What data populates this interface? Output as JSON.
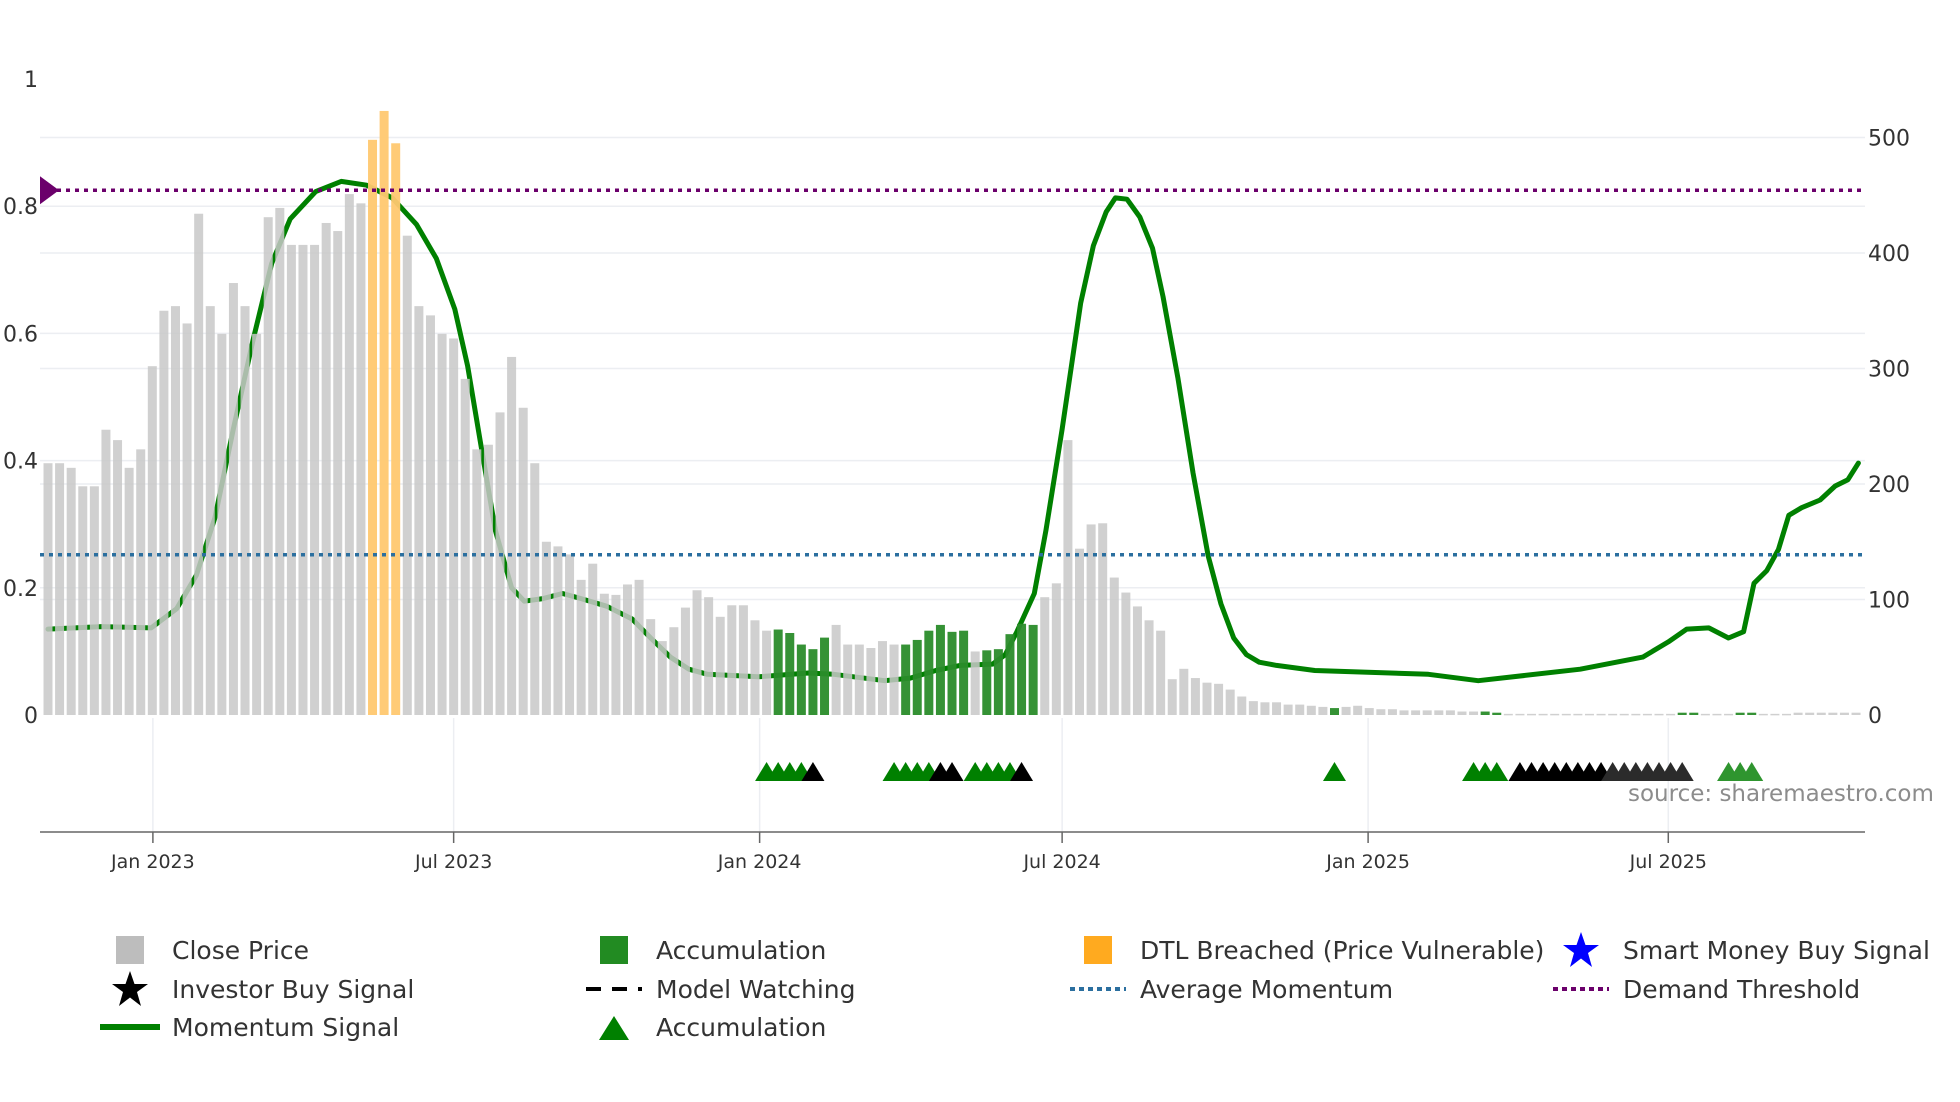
{
  "chart_data": {
    "type": "bar",
    "title": "",
    "source": "source: sharemaestro.com",
    "x_unit": "week index (weekly bars)",
    "x_ticks": [
      {
        "label": "Jan 2023",
        "week": 9.05
      },
      {
        "label": "Jul 2023",
        "week": 35.0
      },
      {
        "label": "Jan 2024",
        "week": 61.4
      },
      {
        "label": "Jul 2024",
        "week": 87.5
      },
      {
        "label": "Jan 2025",
        "week": 113.9
      },
      {
        "label": "Jul 2025",
        "week": 139.8
      }
    ],
    "y_left": {
      "ticks": [
        "0",
        "0.2",
        "0.4",
        "0.6",
        "0.8",
        "1"
      ],
      "tick_values": [
        0,
        0.2,
        0.4,
        0.6,
        0.8,
        1
      ],
      "range": [
        0,
        1
      ]
    },
    "y_right": {
      "ticks": [
        "0",
        "100",
        "200",
        "300",
        "400",
        "500"
      ],
      "tick_values": [
        0,
        100,
        200,
        300,
        400,
        500
      ],
      "range": [
        0,
        550
      ]
    },
    "close_price": [
      218,
      218,
      214,
      198,
      198,
      247,
      238,
      214,
      230,
      302,
      350,
      354,
      339,
      434,
      354,
      330,
      374,
      354,
      330,
      431,
      439,
      407,
      407,
      407,
      426,
      419,
      451,
      443,
      498,
      523,
      495,
      415,
      354,
      346,
      330,
      326,
      291,
      230,
      234,
      262,
      310,
      266,
      218,
      150,
      146,
      139,
      117,
      131,
      105,
      104,
      113,
      117,
      83,
      64,
      76,
      93,
      108,
      102,
      85,
      95,
      95,
      82,
      73,
      74,
      71,
      61,
      57,
      67,
      78,
      61,
      61,
      58,
      64,
      61,
      61,
      65,
      73,
      78,
      72,
      73,
      55,
      56,
      57,
      70,
      79,
      78,
      102,
      114,
      238,
      144,
      165,
      166,
      119,
      106,
      94,
      82,
      73,
      31,
      40,
      32,
      28,
      27,
      22,
      16,
      12,
      11,
      11,
      9,
      9,
      8,
      7,
      6,
      7,
      8,
      6,
      5,
      5,
      4,
      4,
      4,
      4,
      4,
      3,
      3,
      3,
      2,
      1,
      1,
      1,
      1,
      1,
      1,
      1,
      1,
      1,
      1,
      1,
      1,
      1,
      1,
      1,
      2,
      2,
      1,
      1,
      1,
      2,
      2,
      1,
      1,
      1,
      2,
      2,
      2,
      2,
      2,
      2
    ],
    "accumulation_weeks": [
      63,
      64,
      65,
      66,
      67,
      74,
      75,
      76,
      77,
      78,
      79,
      81,
      82,
      83,
      84,
      85,
      111,
      124,
      125,
      141,
      142,
      146,
      147
    ],
    "dtl_breached_weeks": [
      28,
      29,
      30
    ],
    "momentum_signal": [
      [
        0,
        0.135
      ],
      [
        4.6,
        0.139
      ],
      [
        8.9,
        0.137
      ],
      [
        11.1,
        0.167
      ],
      [
        12.8,
        0.22
      ],
      [
        14.4,
        0.31
      ],
      [
        16.0,
        0.45
      ],
      [
        17.7,
        0.59
      ],
      [
        19.3,
        0.71
      ],
      [
        20.9,
        0.78
      ],
      [
        23.1,
        0.823
      ],
      [
        25.3,
        0.839
      ],
      [
        27.5,
        0.833
      ],
      [
        29.7,
        0.813
      ],
      [
        31.8,
        0.771
      ],
      [
        33.5,
        0.718
      ],
      [
        35.1,
        0.638
      ],
      [
        36.2,
        0.549
      ],
      [
        37.3,
        0.43
      ],
      [
        38.6,
        0.29
      ],
      [
        40.0,
        0.2
      ],
      [
        41.1,
        0.179
      ],
      [
        42.7,
        0.183
      ],
      [
        44.4,
        0.191
      ],
      [
        46.0,
        0.183
      ],
      [
        48.2,
        0.171
      ],
      [
        50.4,
        0.151
      ],
      [
        52.0,
        0.121
      ],
      [
        53.7,
        0.091
      ],
      [
        55.3,
        0.072
      ],
      [
        56.9,
        0.064
      ],
      [
        61.3,
        0.06
      ],
      [
        65.6,
        0.066
      ],
      [
        67.8,
        0.064
      ],
      [
        72.2,
        0.054
      ],
      [
        74.4,
        0.058
      ],
      [
        76.6,
        0.07
      ],
      [
        78.7,
        0.078
      ],
      [
        81.5,
        0.08
      ],
      [
        82.6,
        0.095
      ],
      [
        83.6,
        0.131
      ],
      [
        85.1,
        0.191
      ],
      [
        86.1,
        0.29
      ],
      [
        87.5,
        0.449
      ],
      [
        89.1,
        0.648
      ],
      [
        90.2,
        0.738
      ],
      [
        91.3,
        0.791
      ],
      [
        92.1,
        0.813
      ],
      [
        93.1,
        0.811
      ],
      [
        94.2,
        0.783
      ],
      [
        95.3,
        0.734
      ],
      [
        96.2,
        0.658
      ],
      [
        97.5,
        0.529
      ],
      [
        98.8,
        0.38
      ],
      [
        100.1,
        0.25
      ],
      [
        101.2,
        0.175
      ],
      [
        102.3,
        0.121
      ],
      [
        103.4,
        0.095
      ],
      [
        104.5,
        0.083
      ],
      [
        106.0,
        0.078
      ],
      [
        109.3,
        0.07
      ],
      [
        119.1,
        0.064
      ],
      [
        123.4,
        0.054
      ],
      [
        132.2,
        0.072
      ],
      [
        137.6,
        0.091
      ],
      [
        139.8,
        0.115
      ],
      [
        141.4,
        0.135
      ],
      [
        143.3,
        0.137
      ],
      [
        145.0,
        0.121
      ],
      [
        146.3,
        0.131
      ],
      [
        147.2,
        0.207
      ],
      [
        148.3,
        0.227
      ],
      [
        149.3,
        0.26
      ],
      [
        150.2,
        0.314
      ],
      [
        151.3,
        0.326
      ],
      [
        152.9,
        0.338
      ],
      [
        154.2,
        0.36
      ],
      [
        155.3,
        0.37
      ],
      [
        156.2,
        0.396
      ]
    ],
    "average_momentum": 0.252,
    "demand_threshold": 0.825,
    "signals": {
      "accumulation": [
        62,
        63,
        64,
        65,
        73,
        74,
        75,
        76,
        80,
        81,
        82,
        83,
        111,
        123,
        124,
        125
      ],
      "accumulation_recent": [
        145,
        146,
        147
      ],
      "model_watching": [
        66,
        77,
        78,
        84,
        127,
        128,
        129,
        130,
        131,
        132,
        133,
        134
      ],
      "model_watching_recent": [
        135,
        136,
        137,
        138,
        139,
        140,
        141
      ]
    },
    "colors": {
      "close_price": "#c8c8c8",
      "accumulation": "#2a8c2a",
      "dtl": "#ffc870",
      "momentum": "#008000",
      "average_momentum": "#2b6f9f",
      "demand_threshold": "#6b006b",
      "signal_black": "#000000",
      "signal_dark": "#2b2b2b",
      "signal_green_recent": "#2f952f"
    }
  },
  "legend": [
    {
      "label": "Close Price",
      "icon": "gray-square-icon",
      "color": "#bdbdbd"
    },
    {
      "label": "Accumulation",
      "icon": "green-square-icon",
      "color": "#228b22"
    },
    {
      "label": "DTL Breached (Price Vulnerable)",
      "icon": "orange-square-icon",
      "color": "#ffaa1f"
    },
    {
      "label": "Smart Money Buy Signal",
      "icon": "blue-star-icon",
      "color": "#0000ff"
    },
    {
      "label": "Investor Buy Signal",
      "icon": "black-star-icon",
      "color": "#000000"
    },
    {
      "label": "Model Watching",
      "icon": "dashed-line-icon",
      "color": "#000000"
    },
    {
      "label": "Average Momentum",
      "icon": "dotted-line-icon",
      "color": "#2b6f9f"
    },
    {
      "label": "Demand Threshold",
      "icon": "dotted-line-icon",
      "color": "#6b006b"
    },
    {
      "label": "Momentum Signal",
      "icon": "solid-line-icon",
      "color": "#008000"
    },
    {
      "label": "Accumulation",
      "icon": "green-triangle-icon",
      "color": "#008000"
    }
  ]
}
